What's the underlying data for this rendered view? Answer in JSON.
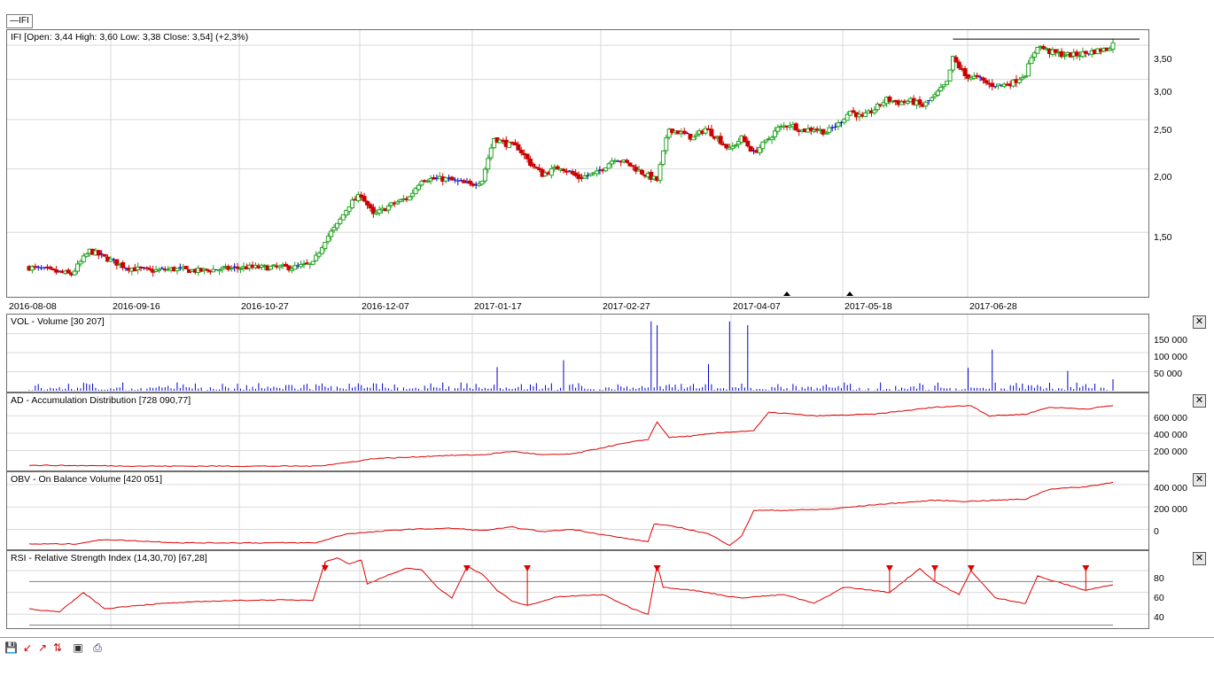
{
  "tab": {
    "label": "IFI"
  },
  "price": {
    "title": "IFI [Open: 3,44  High: 3,60  Low: 3,38  Close: 3,54] (+2,3%)",
    "yticks": [
      "3,50",
      "3,00",
      "2,50",
      "2,00",
      "1,50"
    ],
    "xticks": [
      "2016-08-08",
      "2016-09-16",
      "2016-10-27",
      "2016-12-07",
      "2017-01-17",
      "2017-02-27",
      "2017-04-07",
      "2017-05-18",
      "2017-06-28"
    ]
  },
  "vol": {
    "title": "VOL - Volume [30 207]",
    "yticks": [
      "150 000",
      "100 000",
      "50 000"
    ]
  },
  "ad": {
    "title": "AD - Accumulation Distribution [728 090,77]",
    "yticks": [
      "600 000",
      "400 000",
      "200 000"
    ]
  },
  "obv": {
    "title": "OBV - On Balance Volume [420 051]",
    "yticks": [
      "400 000",
      "200 000",
      "0"
    ]
  },
  "rsi": {
    "title": "RSI - Relative Strength Index (14,30,70) [67,28]",
    "yticks": [
      "80",
      "60",
      "40"
    ]
  },
  "colors": {
    "up": "#1fa31f",
    "down": "#cc0000",
    "flat": "#0000cc",
    "line": "#dd0000",
    "grid": "#d9d9d9"
  },
  "chart_data": [
    {
      "type": "candlestick",
      "title": "IFI [Open: 3,44  High: 3,60  Low: 3,38  Close: 3,54] (+2,3%)",
      "y_scale": "log",
      "last": {
        "open": 3.44,
        "high": 3.6,
        "low": 3.38,
        "close": 3.54,
        "change_pct": 2.3
      },
      "x_ticks": [
        "2016-08-08",
        "2016-09-16",
        "2016-10-27",
        "2016-12-07",
        "2017-01-17",
        "2017-02-27",
        "2017-04-07",
        "2017-05-18",
        "2017-06-28"
      ],
      "close_path": [
        [
          0,
          1.28
        ],
        [
          7,
          1.26
        ],
        [
          14,
          1.24
        ],
        [
          20,
          1.38
        ],
        [
          26,
          1.33
        ],
        [
          32,
          1.28
        ],
        [
          40,
          1.26
        ],
        [
          48,
          1.27
        ],
        [
          56,
          1.26
        ],
        [
          64,
          1.27
        ],
        [
          72,
          1.28
        ],
        [
          80,
          1.28
        ],
        [
          88,
          1.28
        ],
        [
          94,
          1.3
        ],
        [
          98,
          1.45
        ],
        [
          102,
          1.55
        ],
        [
          106,
          1.7
        ],
        [
          110,
          1.78
        ],
        [
          114,
          1.62
        ],
        [
          120,
          1.7
        ],
        [
          126,
          1.76
        ],
        [
          130,
          1.91
        ],
        [
          138,
          1.91
        ],
        [
          146,
          1.86
        ],
        [
          150,
          1.9
        ],
        [
          154,
          2.3
        ],
        [
          158,
          2.24
        ],
        [
          162,
          2.2
        ],
        [
          166,
          2.05
        ],
        [
          170,
          1.95
        ],
        [
          176,
          2.02
        ],
        [
          182,
          1.92
        ],
        [
          188,
          1.96
        ],
        [
          194,
          2.1
        ],
        [
          198,
          2.05
        ],
        [
          204,
          1.95
        ],
        [
          208,
          1.9
        ],
        [
          212,
          2.4
        ],
        [
          216,
          2.35
        ],
        [
          220,
          2.3
        ],
        [
          224,
          2.4
        ],
        [
          228,
          2.3
        ],
        [
          232,
          2.18
        ],
        [
          236,
          2.3
        ],
        [
          240,
          2.15
        ],
        [
          244,
          2.26
        ],
        [
          248,
          2.4
        ],
        [
          252,
          2.45
        ],
        [
          256,
          2.38
        ],
        [
          260,
          2.4
        ],
        [
          264,
          2.36
        ],
        [
          268,
          2.45
        ],
        [
          272,
          2.6
        ],
        [
          276,
          2.52
        ],
        [
          280,
          2.62
        ],
        [
          284,
          2.74
        ],
        [
          288,
          2.7
        ],
        [
          292,
          2.72
        ],
        [
          296,
          2.66
        ],
        [
          300,
          2.78
        ],
        [
          304,
          2.95
        ],
        [
          306,
          3.3
        ],
        [
          310,
          3.05
        ],
        [
          314,
          3.02
        ],
        [
          318,
          2.93
        ],
        [
          322,
          2.92
        ],
        [
          326,
          2.96
        ],
        [
          330,
          3.08
        ],
        [
          334,
          3.5
        ],
        [
          338,
          3.4
        ],
        [
          342,
          3.36
        ],
        [
          346,
          3.35
        ],
        [
          350,
          3.38
        ],
        [
          354,
          3.42
        ],
        [
          357,
          3.44
        ],
        [
          359,
          3.54
        ]
      ],
      "resistance_level": 3.6,
      "markers": [
        "2017-04-07",
        "2017-05-18"
      ]
    },
    {
      "type": "bar",
      "title": "VOL - Volume [30 207]",
      "last": 30207,
      "y_ticks": [
        "150 000",
        "100 000",
        "50 000"
      ],
      "spikes": [
        {
          "x": 155,
          "value": 62000
        },
        {
          "x": 177,
          "value": 80000
        },
        {
          "x": 206,
          "value": 182000
        },
        {
          "x": 208,
          "value": 172000
        },
        {
          "x": 232,
          "value": 182000
        },
        {
          "x": 238,
          "value": 172000
        },
        {
          "x": 225,
          "value": 70000
        },
        {
          "x": 311,
          "value": 60000
        },
        {
          "x": 319,
          "value": 108000
        },
        {
          "x": 344,
          "value": 52000
        }
      ]
    },
    {
      "type": "line",
      "title": "AD - Accumulation Distribution [728 090,77]",
      "last": 728090.77,
      "y_ticks": [
        "600 000",
        "400 000",
        "200 000"
      ],
      "x": [
        0,
        20,
        40,
        70,
        95,
        105,
        115,
        125,
        135,
        150,
        160,
        170,
        180,
        195,
        205,
        208,
        212,
        220,
        230,
        240,
        245,
        250,
        260,
        280,
        300,
        312,
        318,
        330,
        338,
        350,
        359
      ],
      "y": [
        30000,
        25000,
        20000,
        20000,
        20000,
        60000,
        110000,
        120000,
        140000,
        150000,
        190000,
        150000,
        160000,
        270000,
        330000,
        530000,
        350000,
        370000,
        410000,
        430000,
        640000,
        630000,
        600000,
        620000,
        700000,
        720000,
        600000,
        620000,
        700000,
        680000,
        720000
      ]
    },
    {
      "type": "line",
      "title": "OBV - On Balance Volume [420 051]",
      "last": 420051,
      "y_ticks": [
        "400 000",
        "200 000",
        "0"
      ],
      "x": [
        0,
        15,
        25,
        50,
        95,
        105,
        115,
        125,
        140,
        150,
        160,
        170,
        180,
        195,
        205,
        207,
        215,
        225,
        232,
        236,
        240,
        250,
        265,
        280,
        300,
        310,
        320,
        330,
        338,
        350,
        359
      ],
      "y": [
        -130000,
        -130000,
        -90000,
        -120000,
        -120000,
        -40000,
        -20000,
        0,
        10000,
        -10000,
        20000,
        -20000,
        0,
        -70000,
        -110000,
        50000,
        20000,
        -40000,
        -140000,
        -60000,
        170000,
        170000,
        180000,
        220000,
        260000,
        250000,
        260000,
        270000,
        360000,
        380000,
        420051
      ]
    },
    {
      "type": "line",
      "title": "RSI - Relative Strength Index (14,30,70) [67,28]",
      "last": 67.28,
      "y_ticks": [
        "80",
        "60",
        "40"
      ],
      "levels": [
        30,
        70
      ],
      "x": [
        0,
        10,
        18,
        25,
        35,
        45,
        60,
        75,
        94,
        98,
        102,
        106,
        110,
        112,
        118,
        125,
        130,
        135,
        140,
        145,
        150,
        155,
        160,
        165,
        175,
        190,
        200,
        205,
        208,
        210,
        220,
        235,
        250,
        260,
        270,
        285,
        295,
        300,
        308,
        312,
        320,
        330,
        334,
        340,
        350,
        355,
        359
      ],
      "y": [
        45,
        42,
        60,
        45,
        48,
        50,
        52,
        53,
        53,
        88,
        92,
        86,
        90,
        68,
        75,
        82,
        81,
        65,
        55,
        84,
        77,
        62,
        52,
        48,
        56,
        58,
        45,
        40,
        85,
        65,
        62,
        55,
        58,
        50,
        65,
        60,
        82,
        70,
        58,
        80,
        55,
        50,
        75,
        70,
        62,
        65,
        67
      ]
    }
  ]
}
